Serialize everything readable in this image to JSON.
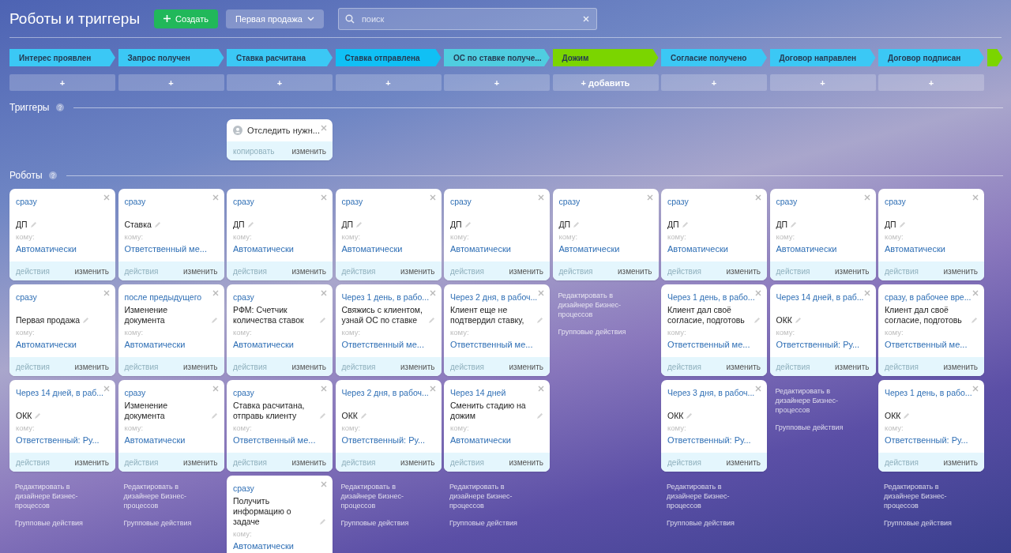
{
  "header": {
    "title": "Роботы и триггеры",
    "create_button": "Создать",
    "category": "Первая продажа",
    "search": {
      "placeholder": "поиск"
    }
  },
  "sections": {
    "triggers": "Триггеры",
    "robots": "Роботы"
  },
  "columns": [
    {
      "stage": {
        "title": "Интерес проявлен",
        "color": "#3bc8f5"
      },
      "add_label": "+",
      "robots": [
        {
          "delay": "сразу",
          "title": "ДП",
          "to": "кому:",
          "recipient": "Автоматически",
          "actions": {
            "label": "действия",
            "disabled": true
          },
          "edit": "изменить"
        },
        {
          "delay": "сразу",
          "title": "Первая продажа",
          "to": "кому:",
          "recipient": "Автоматически",
          "actions": {
            "label": "действия",
            "disabled": true
          },
          "edit": "изменить"
        },
        {
          "delay": "Через 14 дней, в раб...",
          "title": "ОКК",
          "to": "кому:",
          "recipient": "Ответственный: Ру...",
          "actions": {
            "label": "действия",
            "disabled": true
          },
          "edit": "изменить"
        }
      ],
      "footer": {
        "designer_link": "Редактировать в дизайнере Бизнес-процессов",
        "group_actions": "Групповые действия"
      }
    },
    {
      "stage": {
        "title": "Запрос получен",
        "color": "#3bc8f5"
      },
      "add_label": "+",
      "robots": [
        {
          "delay": "сразу",
          "title": "Ставка",
          "to": "кому:",
          "recipient": "Ответственный ме...",
          "actions": {
            "label": "действия",
            "disabled": true
          },
          "edit": "изменить"
        },
        {
          "delay": "после предыдущего",
          "title": "Изменение документа",
          "to": "кому:",
          "recipient": "Автоматически",
          "actions": {
            "label": "действия",
            "disabled": true
          },
          "edit": "изменить"
        },
        {
          "delay": "сразу",
          "title": "Изменение документа",
          "to": "кому:",
          "recipient": "Автоматически",
          "actions": {
            "label": "действия",
            "disabled": true
          },
          "edit": "изменить"
        }
      ],
      "footer": {
        "designer_link": "Редактировать в дизайнере Бизнес-процессов",
        "group_actions": "Групповые действия"
      }
    },
    {
      "stage": {
        "title": "Ставка расчитана",
        "color": "#3bc8f5"
      },
      "add_label": "+",
      "triggers": [
        {
          "title": "Отследить нужн...",
          "copy": {
            "label": "копировать",
            "disabled": true
          },
          "edit": "изменить"
        }
      ],
      "robots": [
        {
          "delay": "сразу",
          "title": "ДП",
          "to": "кому:",
          "recipient": "Автоматически",
          "actions": {
            "label": "действия",
            "disabled": true
          },
          "edit": "изменить"
        },
        {
          "delay": "сразу",
          "title": "РФМ: Счетчик количества ставок",
          "to": "кому:",
          "recipient": "Автоматически",
          "actions": {
            "label": "действия",
            "disabled": true
          },
          "edit": "изменить"
        },
        {
          "delay": "сразу",
          "title": "Ставка расчитана, отправь клиенту",
          "to": "кому:",
          "recipient": "Ответственный ме...",
          "actions": {
            "label": "действия",
            "disabled": true
          },
          "edit": "изменить"
        },
        {
          "delay": "сразу",
          "title": "Получить информацию о задаче",
          "to": "кому:",
          "recipient": "Автоматически"
        }
      ]
    },
    {
      "stage": {
        "title": "Ставка отправлена",
        "color": "#10c0f5"
      },
      "add_label": "+",
      "robots": [
        {
          "delay": "сразу",
          "title": "ДП",
          "to": "кому:",
          "recipient": "Автоматически",
          "actions": {
            "label": "действия",
            "disabled": true
          },
          "edit": "изменить"
        },
        {
          "delay": "Через 1 день, в рабо...",
          "title": "Свяжись с клиентом, узнай ОС по ставке",
          "to": "кому:",
          "recipient": "Ответственный ме...",
          "actions": {
            "label": "действия",
            "disabled": true
          },
          "edit": "изменить"
        },
        {
          "delay": "Через 2 дня, в рабоч...",
          "title": "ОКК",
          "to": "кому:",
          "recipient": "Ответственный: Ру...",
          "actions": {
            "label": "действия",
            "disabled": true
          },
          "edit": "изменить"
        }
      ],
      "footer": {
        "designer_link": "Редактировать в дизайнере Бизнес-процессов",
        "group_actions": "Групповые действия"
      }
    },
    {
      "stage": {
        "title": "ОС по ставке получе...",
        "color": "#4fcde0"
      },
      "add_label": "+",
      "robots": [
        {
          "delay": "сразу",
          "title": "ДП",
          "to": "кому:",
          "recipient": "Автоматически",
          "actions": {
            "label": "действия",
            "disabled": true
          },
          "edit": "изменить"
        },
        {
          "delay": "Через 2 дня, в рабоч...",
          "title": "Клиент еще не подтвердил ставку,",
          "to": "кому:",
          "recipient": "Ответственный ме...",
          "actions": {
            "label": "действия",
            "disabled": true
          },
          "edit": "изменить"
        },
        {
          "delay": "Через 14 дней",
          "title": "Сменить стадию на дожим",
          "to": "кому:",
          "recipient": "Автоматически",
          "actions": {
            "label": "действия",
            "disabled": true
          },
          "edit": "изменить"
        }
      ],
      "footer": {
        "designer_link": "Редактировать в дизайнере Бизнес-процессов",
        "group_actions": "Групповые действия"
      }
    },
    {
      "stage": {
        "title": "Дожим",
        "color": "#7bd500"
      },
      "add_label": "+ добавить",
      "robots": [
        {
          "delay": "сразу",
          "title": "ДП",
          "to": "кому:",
          "recipient": "Автоматически",
          "actions": {
            "label": "действия",
            "disabled": true
          },
          "edit": "изменить"
        }
      ],
      "footer": {
        "designer_link": "Редактировать в дизайнере Бизнес-процессов",
        "group_actions": "Групповые действия"
      }
    },
    {
      "stage": {
        "title": "Согласие получено",
        "color": "#3bc8f5"
      },
      "add_label": "+",
      "robots": [
        {
          "delay": "сразу",
          "title": "ДП",
          "to": "кому:",
          "recipient": "Автоматически",
          "actions": {
            "label": "действия",
            "disabled": true
          },
          "edit": "изменить"
        },
        {
          "delay": "Через 1 день, в рабо...",
          "title": "Клиент дал своё согласие, подготовь",
          "to": "кому:",
          "recipient": "Ответственный ме...",
          "actions": {
            "label": "действия",
            "disabled": true
          },
          "edit": "изменить"
        },
        {
          "delay": "Через 3 дня, в рабоч...",
          "title": "ОКК",
          "to": "кому:",
          "recipient": "Ответственный: Ру...",
          "actions": {
            "label": "действия",
            "disabled": true
          },
          "edit": "изменить"
        }
      ],
      "footer": {
        "designer_link": "Редактировать в дизайнере Бизнес-процессов",
        "group_actions": "Групповые действия"
      }
    },
    {
      "stage": {
        "title": "Договор направлен",
        "color": "#3bc8f5"
      },
      "add_label": "+",
      "robots": [
        {
          "delay": "сразу",
          "title": "ДП",
          "to": "кому:",
          "recipient": "Автоматически",
          "actions": {
            "label": "действия",
            "disabled": true
          },
          "edit": "изменить"
        },
        {
          "delay": "Через 14 дней, в раб...",
          "title": "ОКК",
          "to": "кому:",
          "recipient": "Ответственный: Ру...",
          "actions": {
            "label": "действия",
            "disabled": true
          },
          "edit": "изменить"
        }
      ],
      "footer": {
        "designer_link": "Редактировать в дизайнере Бизнес-процессов",
        "group_actions": "Групповые действия"
      }
    },
    {
      "stage": {
        "title": "Договор подписан",
        "color": "#3bc8f5"
      },
      "add_label": "+",
      "robots": [
        {
          "delay": "сразу",
          "title": "ДП",
          "to": "кому:",
          "recipient": "Автоматически",
          "actions": {
            "label": "действия",
            "disabled": true
          },
          "edit": "изменить"
        },
        {
          "delay": "сразу, в рабочее вре...",
          "title": "Клиент дал своё согласие, подготовь",
          "to": "кому:",
          "recipient": "Ответственный ме...",
          "actions": {
            "label": "действия",
            "disabled": true
          },
          "edit": "изменить"
        },
        {
          "delay": "Через 1 день, в рабо...",
          "title": "ОКК",
          "to": "кому:",
          "recipient": "Ответственный: Ру...",
          "actions": {
            "label": "действия",
            "disabled": true
          },
          "edit": "изменить"
        }
      ],
      "footer": {
        "designer_link": "Редактировать в дизайнере Бизнес-процессов",
        "group_actions": "Групповые действия"
      }
    },
    {
      "stage": {
        "color": "#7bd500"
      }
    }
  ]
}
